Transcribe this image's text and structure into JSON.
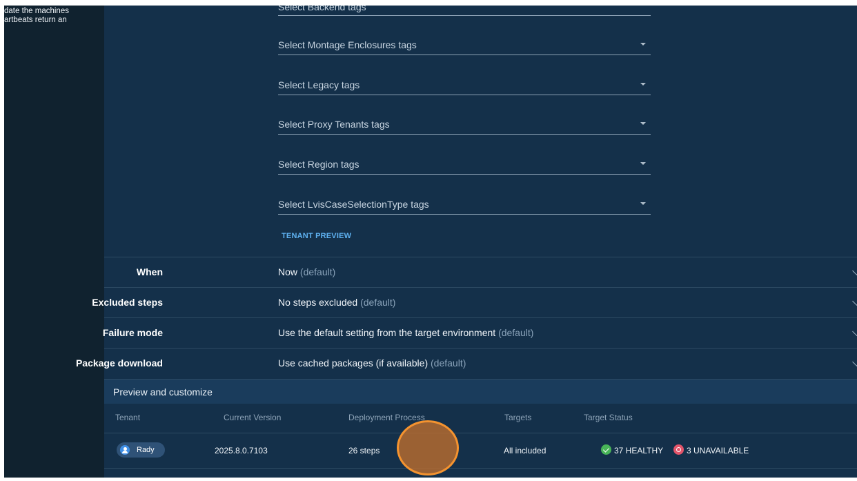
{
  "sidebar": {
    "snippet": "date the machines\nartbeats return an"
  },
  "tag_selects": [
    {
      "placeholder": "Select Backend tags"
    },
    {
      "placeholder": "Select Montage Enclosures tags"
    },
    {
      "placeholder": "Select Legacy tags"
    },
    {
      "placeholder": "Select Proxy Tenants tags"
    },
    {
      "placeholder": "Select Region tags"
    },
    {
      "placeholder": "Select LvisCaseSelectionType tags"
    }
  ],
  "tenant_preview_link": "TENANT PREVIEW",
  "options": [
    {
      "label": "When",
      "value": "Now",
      "note": "(default)"
    },
    {
      "label": "Excluded steps",
      "value": "No steps excluded",
      "note": "(default)"
    },
    {
      "label": "Failure mode",
      "value": "Use the default setting from the target environment",
      "note": "(default)"
    },
    {
      "label": "Package download",
      "value": "Use cached packages (if available)",
      "note": "(default)"
    }
  ],
  "preview": {
    "title": "Preview and customize",
    "columns": [
      "Tenant",
      "Current Version",
      "Deployment Process",
      "Targets",
      "Target Status"
    ],
    "rows": [
      {
        "tenant": "Rady",
        "current_version": "2025.8.0.7103",
        "deployment_process": "26 steps",
        "targets": "All included",
        "healthy": "37 HEALTHY",
        "unavailable": "3 UNAVAILABLE"
      }
    ]
  },
  "colors": {
    "background": "#14304a",
    "sidebar": "#10222f",
    "link": "#5fb2f2",
    "healthy": "#48b458",
    "unavailable": "#e2546a",
    "cursor_highlight": "#f4932f"
  }
}
